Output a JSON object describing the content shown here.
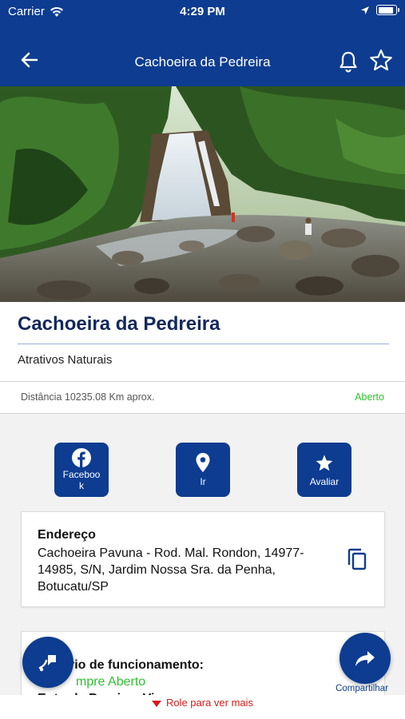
{
  "status_bar": {
    "carrier": "Carrier",
    "time": "4:29 PM"
  },
  "nav": {
    "title": "Cachoeira da Pedreira",
    "back_icon": "back-arrow-icon",
    "bell_icon": "bell-icon",
    "favorite_icon": "star-outline-icon"
  },
  "place": {
    "name": "Cachoeira da Pedreira",
    "category": "Atrativos Naturais",
    "distance": "Distância 10235.08 Km aprox.",
    "status": "Aberto"
  },
  "actions": [
    {
      "label": "Faceboo\nk",
      "icon": "facebook-icon"
    },
    {
      "label": "Ir",
      "icon": "map-pin-icon"
    },
    {
      "label": "Avaliar",
      "icon": "star-icon"
    }
  ],
  "address_card": {
    "heading": "Endereço",
    "text": "Cachoeira Pavuna - Rod. Mal. Rondon, 14977-14985, S/N, Jardim Nossa Sra. da Penha, Botucatu/SP",
    "copy_icon": "copy-icon"
  },
  "hours_card": {
    "heading": "rio de funcionamento:",
    "status": "mpre Aberto",
    "next": "Entrada Proxima Vi"
  },
  "fab": {
    "left_icon": "voice-assist-icon",
    "share_icon": "share-arrow-icon",
    "share_label": "Compartilhar"
  },
  "scroll_hint": "Role para ver mais",
  "colors": {
    "brand": "#0d3c91",
    "title": "#12275c",
    "open": "#2ec12e",
    "hint": "#d81b1b"
  }
}
